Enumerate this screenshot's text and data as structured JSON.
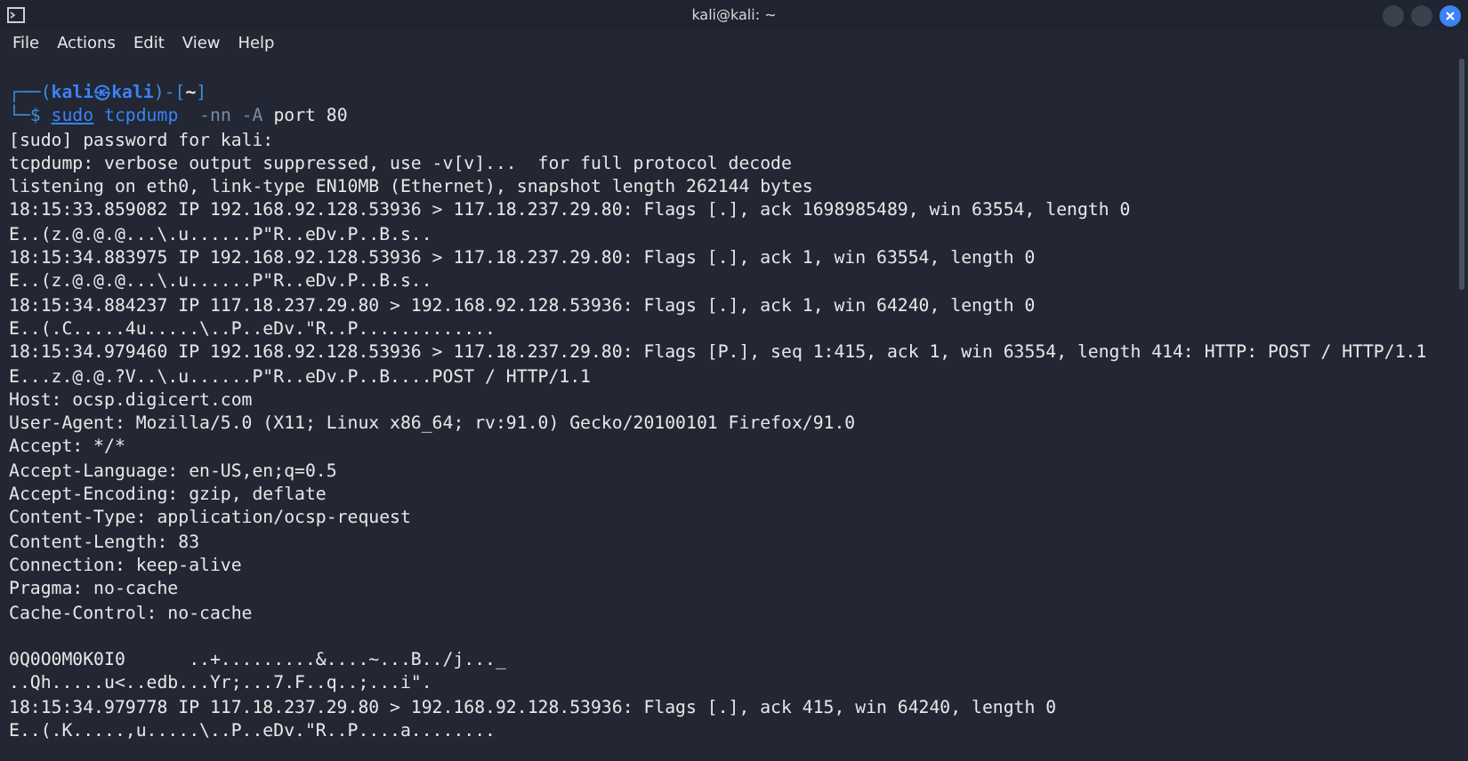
{
  "window": {
    "title": "kali@kali: ~"
  },
  "menu": [
    "File",
    "Actions",
    "Edit",
    "View",
    "Help"
  ],
  "prompt": [
    {
      "text": "┌──(",
      "kind": "frame"
    },
    {
      "text": "kali",
      "kind": "user"
    },
    {
      "text": "㉿",
      "kind": "separator"
    },
    {
      "text": "kali",
      "kind": "host"
    },
    {
      "text": ")-[",
      "kind": "frame"
    },
    {
      "text": "~",
      "kind": "directory"
    },
    {
      "text": "]",
      "kind": "frame"
    }
  ],
  "prompt_symbol": "└─$",
  "command": [
    {
      "text": "sudo",
      "kind": "sudo"
    },
    {
      "text": "tcpdump",
      "kind": "command"
    },
    {
      "text": " -nn -A",
      "kind": "option"
    },
    {
      "text": "port 80",
      "kind": "argument"
    }
  ],
  "output_blocks": [
    [
      "[sudo] password for kali:",
      "tcpdump: verbose output suppressed, use -v[v]...  for full protocol decode",
      "listening on eth0, link-type EN10MB (Ethernet), snapshot length 262144 bytes",
      "18:15:33.859082 IP 192.168.92.128.53936 > 117.18.237.29.80: Flags [.], ack 1698985489, win 63554, length 0",
      "E..(z.@.@.@...\\.u......P\"R..eDv.P..B.s..",
      "18:15:34.883975 IP 192.168.92.128.53936 > 117.18.237.29.80: Flags [.], ack 1, win 63554, length 0",
      "E..(z.@.@.@...\\.u......P\"R..eDv.P..B.s..",
      "18:15:34.884237 IP 117.18.237.29.80 > 192.168.92.128.53936: Flags [.], ack 1, win 64240, length 0",
      "E..(.C.....4u.....\\..P..eDv.\"R..P.............",
      "18:15:34.979460 IP 192.168.92.128.53936 > 117.18.237.29.80: Flags [P.], seq 1:415, ack 1, win 63554, length 414: HTTP: POST / HTTP/1.1",
      "E...z.@.@.?V..\\.u......P\"R..eDv.P..B....POST / HTTP/1.1",
      "Host: ocsp.digicert.com",
      "User-Agent: Mozilla/5.0 (X11; Linux x86_64; rv:91.0) Gecko/20100101 Firefox/91.0",
      "Accept: */*",
      "Accept-Language: en-US,en;q=0.5",
      "Accept-Encoding: gzip, deflate",
      "Content-Type: application/ocsp-request",
      "Content-Length: 83",
      "Connection: keep-alive",
      "Pragma: no-cache",
      "Cache-Control: no-cache"
    ],
    [
      "0Q0O0M0K0I0      ..+.........&....~...B../j..._",
      "..Qh.....u<..edb...Yr;...7.F..q..;...i\".",
      "18:15:34.979778 IP 117.18.237.29.80 > 192.168.92.128.53936: Flags [.], ack 415, win 64240, length 0",
      "E..(.K.....,u.....\\..P..eDv.\"R..P....a........"
    ]
  ]
}
